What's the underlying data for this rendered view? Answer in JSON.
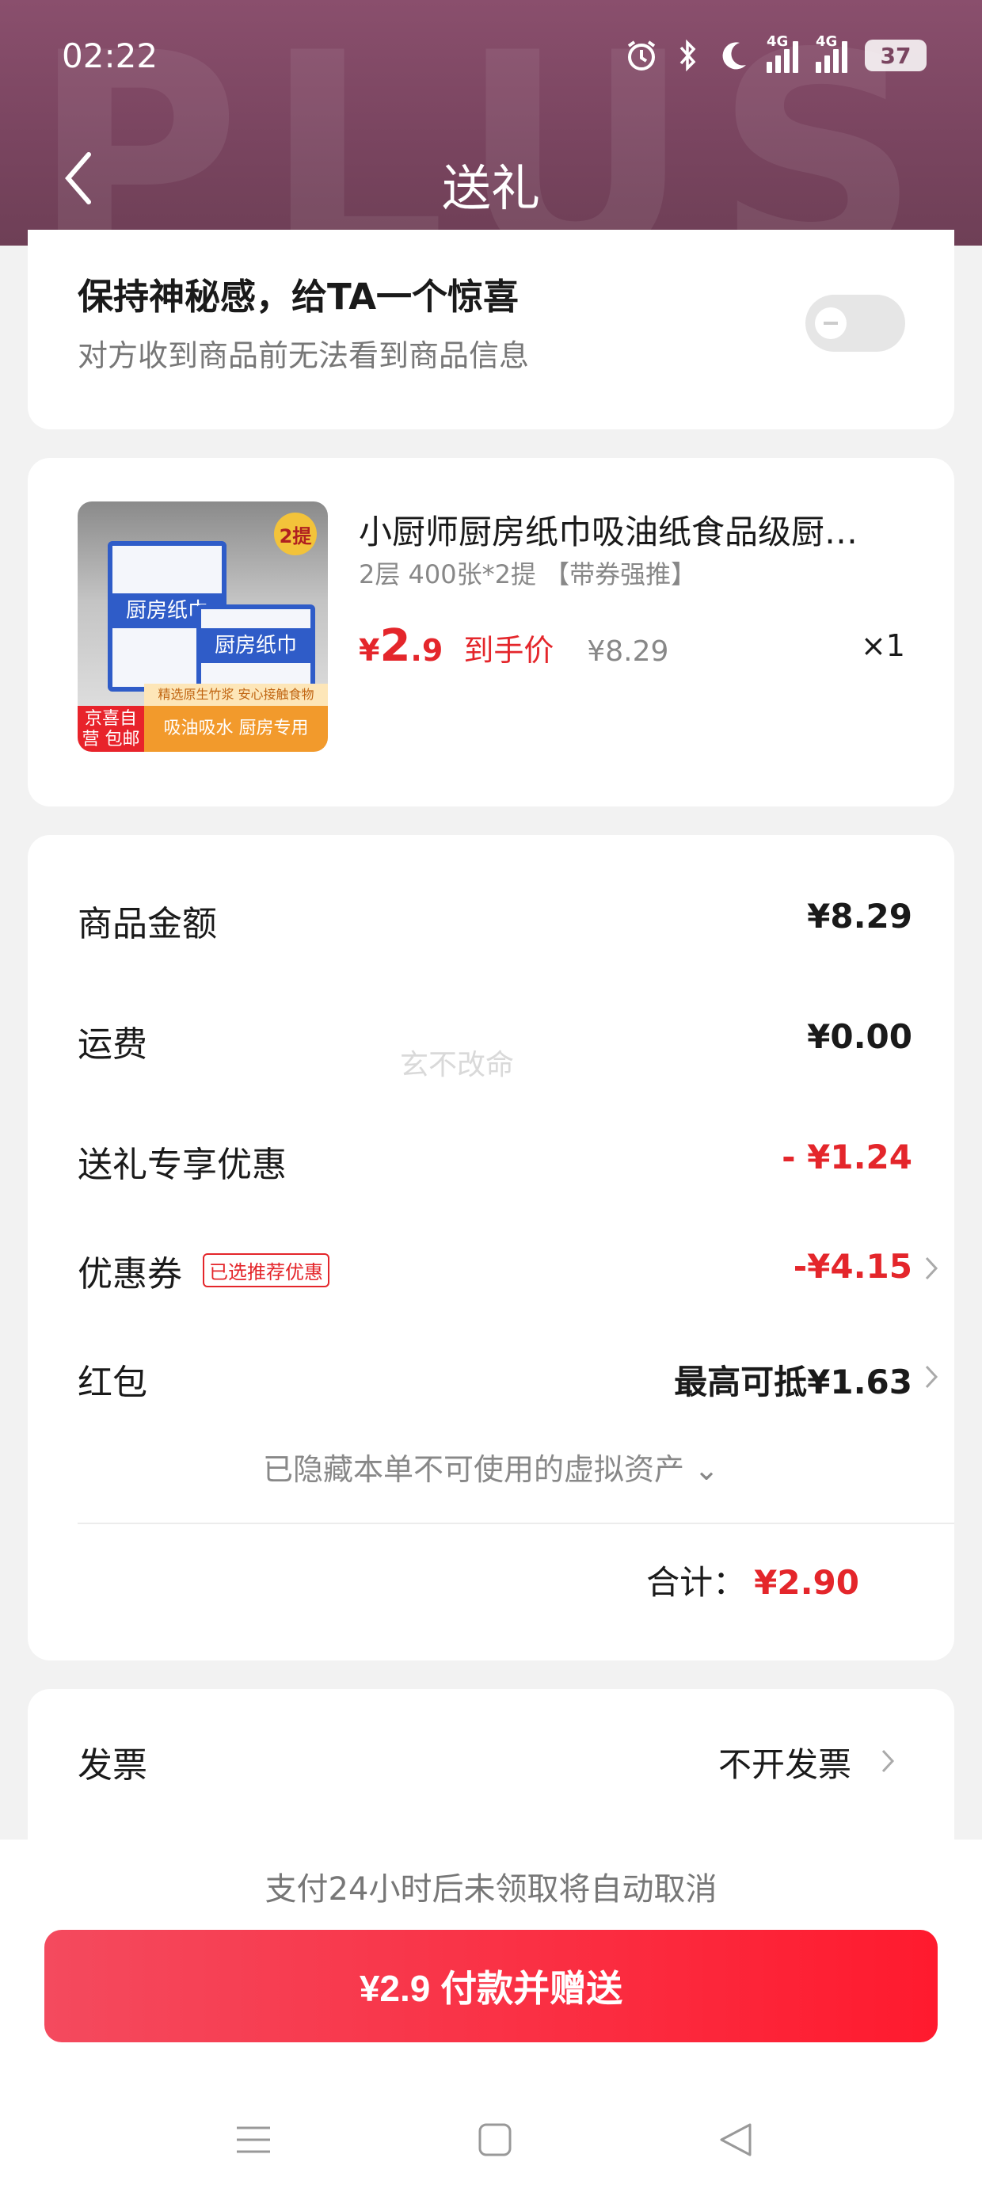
{
  "status_bar": {
    "time": "02:22",
    "network_1": "4G",
    "network_2": "4G",
    "battery": "37"
  },
  "header": {
    "title": "送礼",
    "bg_word": "PLUS"
  },
  "surprise": {
    "title": "保持神秘感，给TA一个惊喜",
    "subtitle": "对方收到商品前无法看到商品信息",
    "toggle_on": false
  },
  "product": {
    "name": "小厨师厨房纸巾吸油纸食品级厨…",
    "spec": "2层 400张*2提 【带券强推】",
    "price_symbol": "¥",
    "price_int": "2",
    "price_dec": ".9",
    "price_label": "到手价",
    "original_price": "¥8.29",
    "quantity": "×1",
    "image": {
      "box_label_1": "厨房纸巾",
      "box_label_2": "厨房纸巾",
      "tag": "2提",
      "badge_l": "京喜自营 包邮",
      "badge_r": "吸油吸水 厨房专用",
      "strip": "精选原生竹浆 安心接触食物"
    }
  },
  "summary": {
    "rows": [
      {
        "label": "商品金额",
        "value": "¥8.29"
      },
      {
        "label": "运费",
        "value": "¥0.00"
      },
      {
        "label": "送礼专享优惠",
        "value": "- ¥1.24"
      },
      {
        "label": "优惠券",
        "badge": "已选推荐优惠",
        "value": "-¥4.15"
      },
      {
        "label": "红包",
        "value": "最高可抵¥1.63"
      }
    ],
    "hidden_assets": "已隐藏本单不可使用的虚拟资产 ⌄",
    "total_label": "合计：",
    "total_value": "¥2.90"
  },
  "watermark": "玄不改命",
  "invoice": {
    "label": "发票",
    "value": "不开发票"
  },
  "footer": {
    "notice": "支付24小时后未领取将自动取消",
    "pay_button": "¥2.9 付款并赠送"
  },
  "colors": {
    "accent_red": "#e4262b",
    "header": "#7a4560",
    "button": "#ff1a2e"
  }
}
